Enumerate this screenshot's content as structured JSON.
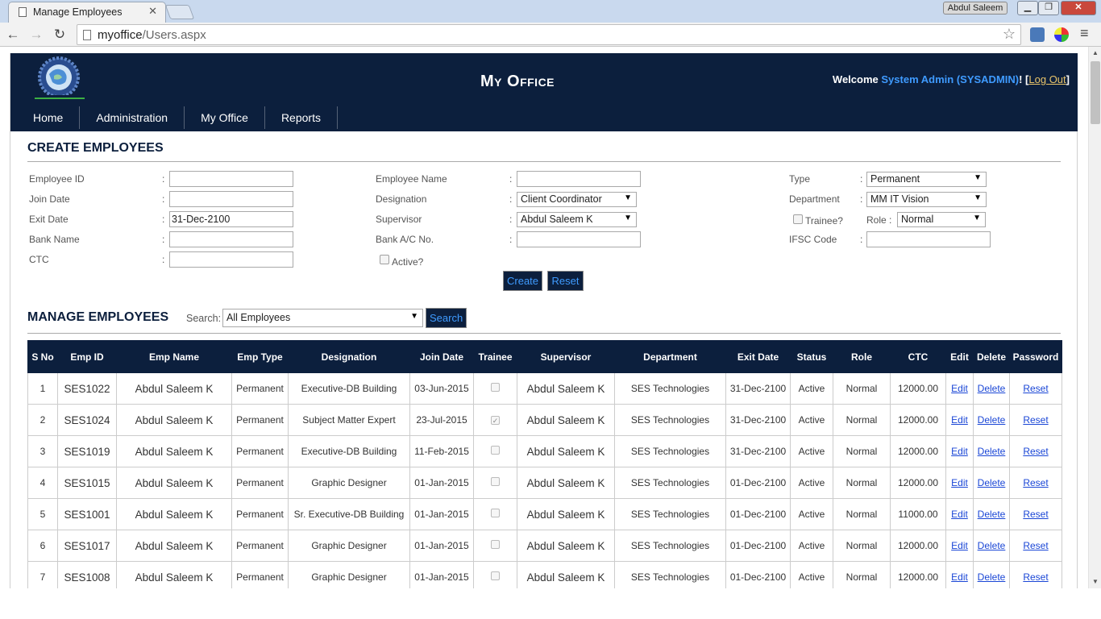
{
  "browser": {
    "tab_title": "Manage Employees",
    "url_host": "myoffice",
    "url_path": "/Users.aspx",
    "window_user": "Abdul Saleem"
  },
  "site": {
    "title": "My Office",
    "welcome_prefix": "Welcome",
    "user_display": "System Admin (SYSADMIN)",
    "logout_label": "Log Out",
    "nav": [
      "Home",
      "Administration",
      "My Office",
      "Reports"
    ]
  },
  "create": {
    "title": "CREATE EMPLOYEES",
    "employee_id_label": "Employee ID",
    "join_date_label": "Join Date",
    "exit_date_label": "Exit Date",
    "exit_date_value": "31-Dec-2100",
    "bank_name_label": "Bank Name",
    "ctc_label": "CTC",
    "employee_name_label": "Employee Name",
    "designation_label": "Designation",
    "designation_value": "Client Coordinator",
    "supervisor_label": "Supervisor",
    "supervisor_value": "Abdul Saleem K",
    "bank_ac_label": "Bank A/C No.",
    "active_label": "Active?",
    "type_label": "Type",
    "type_value": "Permanent",
    "department_label": "Department",
    "department_value": "MM IT Vision",
    "trainee_label": "Trainee?",
    "role_label": "Role :",
    "role_value": "Normal",
    "ifsc_label": "IFSC Code",
    "create_button": "Create",
    "reset_button": "Reset"
  },
  "manage": {
    "title": "MANAGE EMPLOYEES",
    "search_label": "Search:",
    "search_filter": "All Employees",
    "search_button": "Search",
    "columns": [
      "S No",
      "Emp ID",
      "Emp Name",
      "Emp Type",
      "Designation",
      "Join Date",
      "Trainee",
      "Supervisor",
      "Department",
      "Exit Date",
      "Status",
      "Role",
      "CTC",
      "Edit",
      "Delete",
      "Password"
    ],
    "rows": [
      {
        "sno": "1",
        "emp_id": "SES1022",
        "name": "Abdul Saleem K",
        "type": "Permanent",
        "designation": "Executive-DB Building",
        "join_date": "03-Jun-2015",
        "trainee": false,
        "supervisor": "Abdul Saleem K",
        "department": "SES Technologies",
        "exit_date": "31-Dec-2100",
        "status": "Active",
        "role": "Normal",
        "ctc": "12000.00",
        "edit": "Edit",
        "delete": "Delete",
        "reset": "Reset"
      },
      {
        "sno": "2",
        "emp_id": "SES1024",
        "name": "Abdul Saleem K",
        "type": "Permanent",
        "designation": "Subject Matter Expert",
        "join_date": "23-Jul-2015",
        "trainee": true,
        "supervisor": "Abdul Saleem K",
        "department": "SES Technologies",
        "exit_date": "31-Dec-2100",
        "status": "Active",
        "role": "Normal",
        "ctc": "12000.00",
        "edit": "Edit",
        "delete": "Delete",
        "reset": "Reset"
      },
      {
        "sno": "3",
        "emp_id": "SES1019",
        "name": "Abdul Saleem K",
        "type": "Permanent",
        "designation": "Executive-DB Building",
        "join_date": "11-Feb-2015",
        "trainee": false,
        "supervisor": "Abdul Saleem K",
        "department": "SES Technologies",
        "exit_date": "31-Dec-2100",
        "status": "Active",
        "role": "Normal",
        "ctc": "12000.00",
        "edit": "Edit",
        "delete": "Delete",
        "reset": "Reset"
      },
      {
        "sno": "4",
        "emp_id": "SES1015",
        "name": "Abdul Saleem K",
        "type": "Permanent",
        "designation": "Graphic Designer",
        "join_date": "01-Jan-2015",
        "trainee": false,
        "supervisor": "Abdul Saleem K",
        "department": "SES Technologies",
        "exit_date": "01-Dec-2100",
        "status": "Active",
        "role": "Normal",
        "ctc": "12000.00",
        "edit": "Edit",
        "delete": "Delete",
        "reset": "Reset"
      },
      {
        "sno": "5",
        "emp_id": "SES1001",
        "name": "Abdul Saleem K",
        "type": "Permanent",
        "designation": "Sr. Executive-DB Building",
        "join_date": "01-Jan-2015",
        "trainee": false,
        "supervisor": "Abdul Saleem K",
        "department": "SES Technologies",
        "exit_date": "01-Dec-2100",
        "status": "Active",
        "role": "Normal",
        "ctc": "11000.00",
        "edit": "Edit",
        "delete": "Delete",
        "reset": "Reset"
      },
      {
        "sno": "6",
        "emp_id": "SES1017",
        "name": "Abdul Saleem K",
        "type": "Permanent",
        "designation": "Graphic Designer",
        "join_date": "01-Jan-2015",
        "trainee": false,
        "supervisor": "Abdul Saleem K",
        "department": "SES Technologies",
        "exit_date": "01-Dec-2100",
        "status": "Active",
        "role": "Normal",
        "ctc": "12000.00",
        "edit": "Edit",
        "delete": "Delete",
        "reset": "Reset"
      },
      {
        "sno": "7",
        "emp_id": "SES1008",
        "name": "Abdul Saleem K",
        "type": "Permanent",
        "designation": "Graphic Designer",
        "join_date": "01-Jan-2015",
        "trainee": false,
        "supervisor": "Abdul Saleem K",
        "department": "SES Technologies",
        "exit_date": "01-Dec-2100",
        "status": "Active",
        "role": "Normal",
        "ctc": "12000.00",
        "edit": "Edit",
        "delete": "Delete",
        "reset": "Reset"
      }
    ]
  },
  "colors": {
    "header_bg": "#0c1f3d",
    "accent_blue": "#3f9bff",
    "link_blue": "#1a46d6",
    "logout_gold": "#e9c46a"
  }
}
